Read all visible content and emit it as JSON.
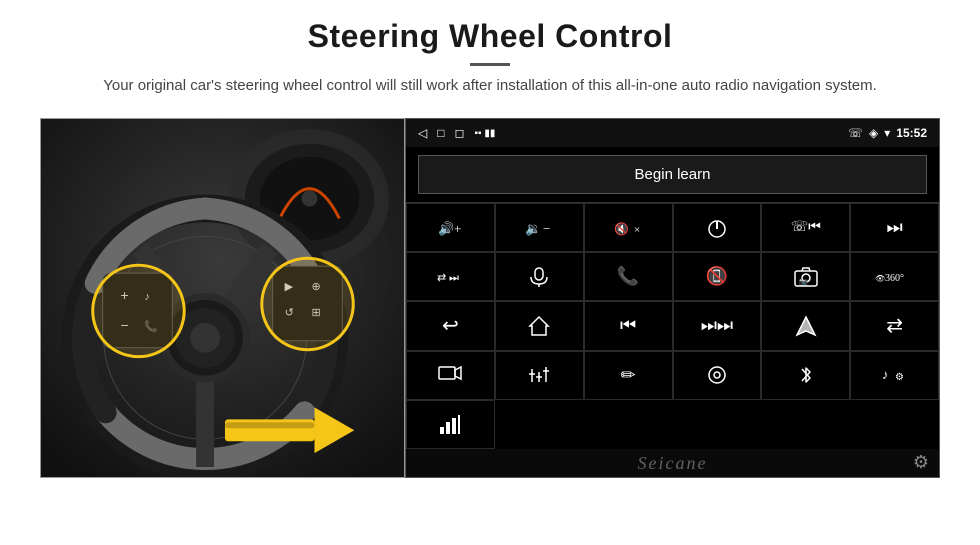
{
  "header": {
    "title": "Steering Wheel Control",
    "subtitle": "Your original car's steering wheel control will still work after installation of this all-in-one auto radio navigation system."
  },
  "status_bar": {
    "nav_back": "◁",
    "nav_home": "□",
    "nav_recent": "◻",
    "signal_icons": "▪▪",
    "phone_icon": "☏",
    "location_icon": "◈",
    "wifi_icon": "▾",
    "time": "15:52"
  },
  "begin_learn": {
    "label": "Begin learn"
  },
  "controls": [
    {
      "id": "vol-up",
      "icon": "🔊+",
      "symbol": "vol_up"
    },
    {
      "id": "vol-down",
      "icon": "🔉−",
      "symbol": "vol_down"
    },
    {
      "id": "mute",
      "icon": "🔇×",
      "symbol": "mute"
    },
    {
      "id": "power",
      "icon": "⏻",
      "symbol": "power"
    },
    {
      "id": "phone-prev",
      "icon": "📞⏮",
      "symbol": "phone_prev"
    },
    {
      "id": "next-track",
      "icon": "⏭",
      "symbol": "next_track"
    },
    {
      "id": "shuffle",
      "icon": "⇄⏭",
      "symbol": "shuffle"
    },
    {
      "id": "mic",
      "icon": "🎤",
      "symbol": "mic"
    },
    {
      "id": "phone",
      "icon": "📞",
      "symbol": "phone"
    },
    {
      "id": "hang-up",
      "icon": "📵",
      "symbol": "hang_up"
    },
    {
      "id": "camera",
      "icon": "📷",
      "symbol": "camera"
    },
    {
      "id": "360",
      "icon": "360°",
      "symbol": "360"
    },
    {
      "id": "back",
      "icon": "↩",
      "symbol": "back"
    },
    {
      "id": "home",
      "icon": "⌂",
      "symbol": "home"
    },
    {
      "id": "rewind",
      "icon": "⏮⏮",
      "symbol": "rewind"
    },
    {
      "id": "ff",
      "icon": "⏭⏭",
      "symbol": "fast_forward"
    },
    {
      "id": "navigate",
      "icon": "➤",
      "symbol": "navigate"
    },
    {
      "id": "swap",
      "icon": "⇄",
      "symbol": "swap"
    },
    {
      "id": "rec",
      "icon": "📷●",
      "symbol": "record"
    },
    {
      "id": "equalizer",
      "icon": "🎚",
      "symbol": "equalizer"
    },
    {
      "id": "edit",
      "icon": "✏",
      "symbol": "edit"
    },
    {
      "id": "settings2",
      "icon": "⊙",
      "symbol": "settings2"
    },
    {
      "id": "bluetooth",
      "icon": "✦",
      "symbol": "bluetooth"
    },
    {
      "id": "music-settings",
      "icon": "♪⚙",
      "symbol": "music_settings"
    },
    {
      "id": "volume-bar",
      "icon": "📊",
      "symbol": "volume_bar"
    },
    {
      "id": "empty1",
      "icon": "",
      "symbol": "empty1"
    },
    {
      "id": "empty2",
      "icon": "",
      "symbol": "empty2"
    },
    {
      "id": "empty3",
      "icon": "",
      "symbol": "empty3"
    },
    {
      "id": "empty4",
      "icon": "",
      "symbol": "empty4"
    },
    {
      "id": "empty5",
      "icon": "",
      "symbol": "empty5"
    }
  ],
  "watermark": {
    "text": "Seicane"
  },
  "icons": {
    "gear": "⚙"
  }
}
